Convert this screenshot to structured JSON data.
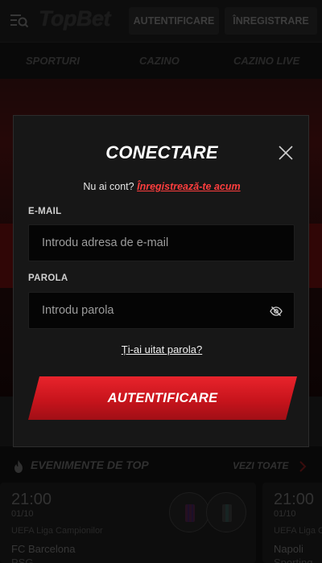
{
  "header": {
    "logo": "TopBet",
    "login_label": "AUTENTIFICARE",
    "register_label": "ÎNREGISTRARE"
  },
  "nav": {
    "items": [
      {
        "label": "SPORTURI"
      },
      {
        "label": "CAZINO"
      },
      {
        "label": "CAZINO LIVE"
      }
    ]
  },
  "top_events": {
    "title": "EVENIMENTE DE TOP",
    "see_all": "VEZI TOATE",
    "cards": [
      {
        "time": "21:00",
        "date": "01/10",
        "league": "UEFA Liga Campionilor",
        "team1": "FC Barcelona",
        "team2": "PSG"
      },
      {
        "time": "21:00",
        "date": "01/10",
        "league": "UEFA Liga C",
        "team1": "Napoli",
        "team2": "Sporting"
      }
    ]
  },
  "modal": {
    "title": "CONECTARE",
    "no_account": "Nu ai cont?",
    "register_link": "Înregistrează-te acum",
    "email_label": "E-MAIL",
    "email_placeholder": "Introdu adresa de e-mail",
    "email_value": "",
    "password_label": "PAROLA",
    "password_placeholder": "Introdu parola",
    "password_value": "",
    "forgot": "Ți-ai uitat parola?",
    "submit": "AUTENTIFICARE"
  },
  "colors": {
    "accent": "#e8242c",
    "link": "#ff3e3e",
    "modal_bg": "#171717",
    "input_bg": "#050505"
  },
  "icons": {
    "menu": "menu-search-icon",
    "close": "close-icon",
    "eye": "eye-slash-icon",
    "fire": "fire-icon",
    "chevron": "chevron-right-icon"
  }
}
